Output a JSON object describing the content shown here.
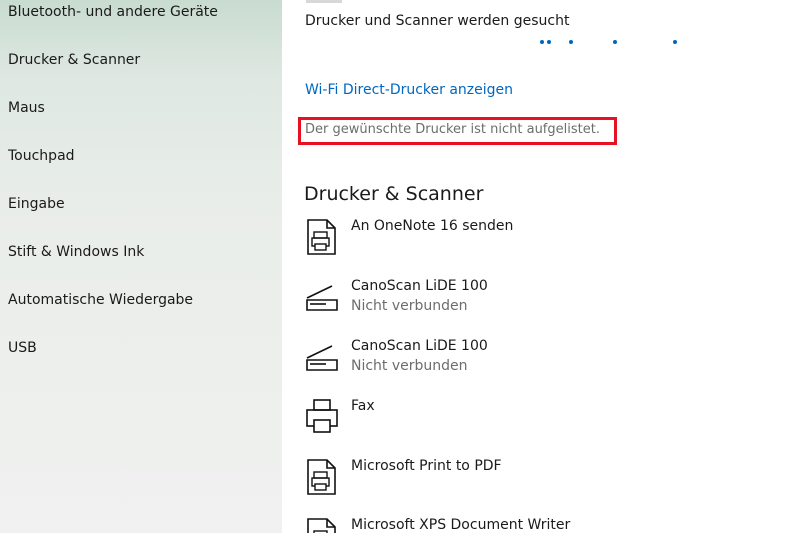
{
  "sidebar": {
    "items": [
      {
        "label": "Bluetooth- und andere Geräte"
      },
      {
        "label": "Drucker & Scanner"
      },
      {
        "label": "Maus"
      },
      {
        "label": "Touchpad"
      },
      {
        "label": "Eingabe"
      },
      {
        "label": "Stift & Windows Ink"
      },
      {
        "label": "Automatische Wiedergabe"
      },
      {
        "label": "USB"
      }
    ]
  },
  "main": {
    "searching_text": "Drucker und Scanner werden gesucht",
    "wifi_direct_link": "Wi-Fi Direct-Drucker anzeigen",
    "not_listed_link": "Der gewünschte Drucker ist nicht aufgelistet.",
    "section_title": "Drucker & Scanner",
    "devices": [
      {
        "name": "An OneNote 16 senden",
        "status": "",
        "icon": "printer-document-icon"
      },
      {
        "name": "CanoScan LiDE 100",
        "status": "Nicht verbunden",
        "icon": "scanner-icon"
      },
      {
        "name": "CanoScan LiDE 100",
        "status": "Nicht verbunden",
        "icon": "scanner-icon"
      },
      {
        "name": "Fax",
        "status": "",
        "icon": "fax-printer-icon"
      },
      {
        "name": "Microsoft Print to PDF",
        "status": "",
        "icon": "printer-document-icon"
      },
      {
        "name": "Microsoft XPS Document Writer",
        "status": "",
        "icon": "printer-document-icon"
      }
    ]
  },
  "colors": {
    "accent": "#0067c0",
    "highlight_border": "#e81123"
  }
}
